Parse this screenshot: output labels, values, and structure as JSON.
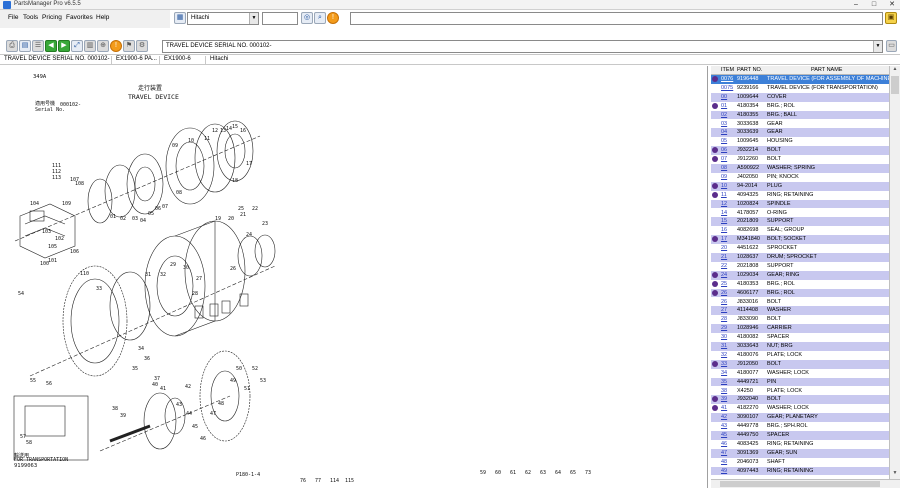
{
  "window": {
    "title": "PartsManager Pro v6.5.5"
  },
  "menu": [
    "File",
    "Tools",
    "Pricing",
    "Favorites",
    "Help"
  ],
  "topbar": {
    "brand": "Hitachi",
    "search_value": ""
  },
  "toolbar2": {
    "section_value": "TRAVEL DEVICE SERIAL NO. 000102-"
  },
  "infobar": [
    "TRAVEL DEVICE SERIAL NO. 000102-",
    "EX1900-6  PA...",
    "EX1900-6",
    "Hitachi"
  ],
  "diagram": {
    "page_code": "349A",
    "title_jp": "走行装置",
    "title_en": "TRAVEL DEVICE",
    "serial_jp": "適用号機",
    "serial_en": "Serial No.",
    "serial_value": "000102-",
    "transport_jp": "輸送用",
    "transport_en": "FOR TRANSPORTATION",
    "part_no": "9199063",
    "page_ref": "P180-1-4",
    "callouts": [
      "111",
      "112",
      "113",
      "107",
      "108",
      "109",
      "104",
      "105",
      "106",
      "102",
      "103",
      "101",
      "110",
      "100",
      "01",
      "02",
      "03",
      "04",
      "05",
      "06",
      "07",
      "08",
      "09",
      "10",
      "11",
      "12",
      "13",
      "14",
      "15",
      "16",
      "17",
      "18",
      "19",
      "20",
      "21",
      "22",
      "23",
      "24",
      "25",
      "26",
      "27",
      "28",
      "29",
      "30",
      "31",
      "32",
      "33",
      "34",
      "35",
      "36",
      "37",
      "38",
      "39",
      "40",
      "41",
      "42",
      "43",
      "44",
      "45",
      "46",
      "47",
      "48",
      "49",
      "50",
      "51",
      "52",
      "53",
      "54",
      "55",
      "56",
      "57",
      "58",
      "59",
      "60",
      "61",
      "62",
      "63",
      "64",
      "65",
      "73",
      "76",
      "77",
      "114",
      "115"
    ]
  },
  "table": {
    "headers": [
      "ITEM",
      "PART NO.",
      "PART NAME"
    ],
    "rows": [
      {
        "item": "0076",
        "pn": "9196448",
        "name": "TRAVEL DEVICE (FOR ASSEMBLY OF MACHINE)",
        "mark": true,
        "sel": true
      },
      {
        "item": "0075",
        "pn": "9239166",
        "name": "TRAVEL DEVICE (FOR TRANSPORTATION)",
        "mark": false
      },
      {
        "item": "00",
        "pn": "1009644",
        "name": "COVER",
        "mark": false
      },
      {
        "item": "01",
        "pn": "4180354",
        "name": "BRG.; ROL",
        "mark": true
      },
      {
        "item": "02",
        "pn": "4180355",
        "name": "BRG.; BALL",
        "mark": false
      },
      {
        "item": "03",
        "pn": "3033638",
        "name": "GEAR",
        "mark": false
      },
      {
        "item": "04",
        "pn": "3033639",
        "name": "GEAR",
        "mark": false
      },
      {
        "item": "05",
        "pn": "1009645",
        "name": "HOUSING",
        "mark": false
      },
      {
        "item": "06",
        "pn": "J932214",
        "name": "BOLT",
        "mark": true
      },
      {
        "item": "07",
        "pn": "J912260",
        "name": "BOLT",
        "mark": true
      },
      {
        "item": "08",
        "pn": "A590922",
        "name": "WASHER; SPRING",
        "mark": false
      },
      {
        "item": "09",
        "pn": "J402050",
        "name": "PIN; KNOCK",
        "mark": false
      },
      {
        "item": "10",
        "pn": "94-2014",
        "name": "PLUG",
        "mark": true
      },
      {
        "item": "11",
        "pn": "4094325",
        "name": "RING; RETAINING",
        "mark": true
      },
      {
        "item": "12",
        "pn": "1020824",
        "name": "SPINDLE",
        "mark": false
      },
      {
        "item": "14",
        "pn": "4178057",
        "name": "O-RING",
        "mark": false
      },
      {
        "item": "15",
        "pn": "2021809",
        "name": "SUPPORT",
        "mark": false
      },
      {
        "item": "16",
        "pn": "4082698",
        "name": "SEAL; GROUP",
        "mark": false
      },
      {
        "item": "17",
        "pn": "M341840",
        "name": "BOLT; SOCKET",
        "mark": true
      },
      {
        "item": "20",
        "pn": "4451622",
        "name": "SPROCKET",
        "mark": false
      },
      {
        "item": "21",
        "pn": "1028637",
        "name": "DRUM; SPROCKET",
        "mark": false
      },
      {
        "item": "22",
        "pn": "2021808",
        "name": "SUPPORT",
        "mark": false
      },
      {
        "item": "24",
        "pn": "1029034",
        "name": "GEAR; RING",
        "mark": true
      },
      {
        "item": "25",
        "pn": "4180353",
        "name": "BRG.; ROL",
        "mark": true
      },
      {
        "item": "26",
        "pn": "4606177",
        "name": "BRG.; ROL",
        "mark": true
      },
      {
        "item": "26",
        "pn": "J833016",
        "name": "BOLT",
        "mark": false
      },
      {
        "item": "27",
        "pn": "4114408",
        "name": "WASHER",
        "mark": false
      },
      {
        "item": "28",
        "pn": "J833090",
        "name": "BOLT",
        "mark": false
      },
      {
        "item": "29",
        "pn": "1028946",
        "name": "CARRIER",
        "mark": false
      },
      {
        "item": "30",
        "pn": "4180082",
        "name": "SPACER",
        "mark": false
      },
      {
        "item": "31",
        "pn": "3033643",
        "name": "NUT; BRG",
        "mark": false
      },
      {
        "item": "32",
        "pn": "4180076",
        "name": "PLATE; LOCK",
        "mark": false
      },
      {
        "item": "33",
        "pn": "J912050",
        "name": "BOLT",
        "mark": true
      },
      {
        "item": "34",
        "pn": "4180077",
        "name": "WASHER; LOCK",
        "mark": false
      },
      {
        "item": "35",
        "pn": "4449721",
        "name": "PIN",
        "mark": false
      },
      {
        "item": "38",
        "pn": "X4250",
        "name": "PLATE; LOCK",
        "mark": false
      },
      {
        "item": "39",
        "pn": "J932040",
        "name": "BOLT",
        "mark": true
      },
      {
        "item": "41",
        "pn": "4182270",
        "name": "WASHER; LOCK",
        "mark": true
      },
      {
        "item": "42",
        "pn": "3090107",
        "name": "GEAR; PLANETARY",
        "mark": false
      },
      {
        "item": "43",
        "pn": "4449778",
        "name": "BRG.; SPH.ROL",
        "mark": false
      },
      {
        "item": "45",
        "pn": "4449750",
        "name": "SPACER",
        "mark": false
      },
      {
        "item": "46",
        "pn": "4083425",
        "name": "RING; RETAINING",
        "mark": false
      },
      {
        "item": "47",
        "pn": "3091369",
        "name": "GEAR; SUN",
        "mark": false
      },
      {
        "item": "48",
        "pn": "2046073",
        "name": "SHAFT",
        "mark": false
      },
      {
        "item": "49",
        "pn": "4097443",
        "name": "RING; RETAINING",
        "mark": false
      }
    ]
  }
}
